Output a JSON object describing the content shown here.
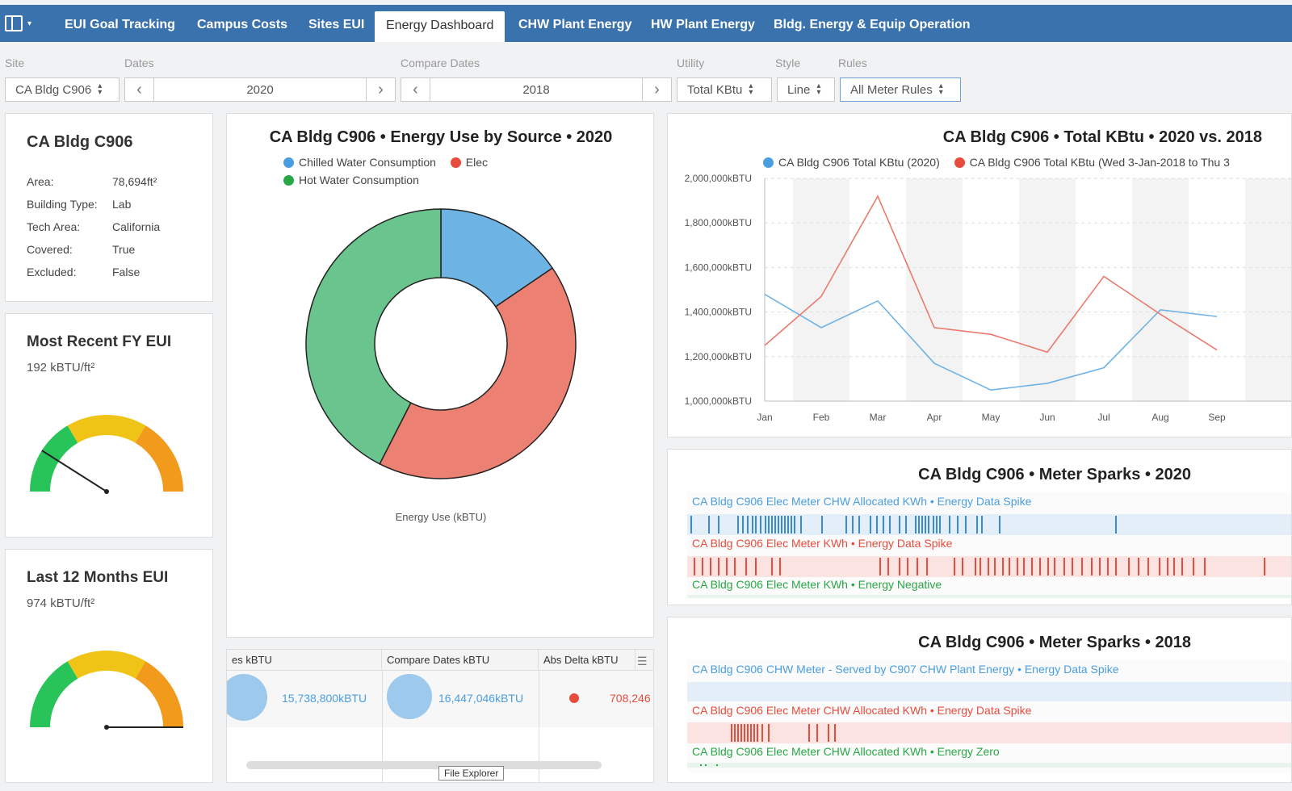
{
  "nav": {
    "tabs": [
      {
        "label": "EUI Goal Tracking"
      },
      {
        "label": "Campus Costs"
      },
      {
        "label": "Sites EUI"
      },
      {
        "label": "Energy Dashboard"
      },
      {
        "label": "CHW Plant Energy"
      },
      {
        "label": "HW Plant Energy"
      },
      {
        "label": "Bldg. Energy & Equip Operation"
      }
    ]
  },
  "filters": {
    "site_label": "Site",
    "site_value": "CA Bldg C906",
    "dates_label": "Dates",
    "dates_value": "2020",
    "compare_label": "Compare Dates",
    "compare_value": "2018",
    "utility_label": "Utility",
    "utility_value": "Total KBtu",
    "style_label": "Style",
    "style_value": "Line",
    "rules_label": "Rules",
    "rules_value": "All Meter Rules"
  },
  "building": {
    "title": "CA Bldg C906",
    "rows": [
      {
        "k": "Area:",
        "v": "78,694ft²"
      },
      {
        "k": "Building Type:",
        "v": "Lab"
      },
      {
        "k": "Tech Area:",
        "v": "California"
      },
      {
        "k": "Covered:",
        "v": "True"
      },
      {
        "k": "Excluded:",
        "v": "False"
      }
    ]
  },
  "eui_recent": {
    "title": "Most Recent FY EUI",
    "value": "192 kBTU/ft²",
    "level": 0.18
  },
  "eui_12m": {
    "title": "Last 12 Months EUI",
    "value": "974 kBTU/ft²",
    "level": 1.0
  },
  "donut": {
    "title": "CA Bldg C906 • Energy Use by Source  •  2020",
    "legend": [
      {
        "name": "Chilled Water Consumption",
        "color": "#4a9ee0"
      },
      {
        "name": "Elec",
        "color": "#e84c3d"
      },
      {
        "name": "Hot Water Consumption",
        "color": "#28a745"
      }
    ],
    "footer": "Energy Use (kBTU)"
  },
  "line": {
    "title": "CA Bldg C906  •  Total KBtu  •  2020 vs. 2018",
    "legend1": "CA Bldg C906 Total KBtu (2020)",
    "legend2": "CA Bldg C906 Total KBtu (Wed 3-Jan-2018 to Thu 3"
  },
  "spark2020": {
    "title": "CA Bldg C906  •  Meter Sparks  •  2020",
    "rows": [
      {
        "label": "CA Bldg C906 Elec Meter CHW Allocated KWh • Energy Data Spike"
      },
      {
        "label": "CA Bldg C906 Elec Meter KWh • Energy Data Spike"
      },
      {
        "label": "CA Bldg C906 Elec Meter KWh • Energy Negative"
      }
    ]
  },
  "spark2018": {
    "title": "CA Bldg C906  •  Meter Sparks  •  2018",
    "rows": [
      {
        "label": "CA Bldg C906 CHW Meter - Served by C907 CHW Plant Energy • Energy Data Spike"
      },
      {
        "label": "CA Bldg C906 Elec Meter CHW Allocated KWh • Energy Data Spike"
      },
      {
        "label": "CA Bldg C906 Elec Meter CHW Allocated KWh • Energy Zero"
      }
    ]
  },
  "table": {
    "col1": "es kBTU",
    "col2": "Compare Dates kBTU",
    "col3": "Abs Delta kBTU",
    "v1": "15,738,800kBTU",
    "v2": "16,447,046kBTU",
    "v3": "708,246",
    "tooltip": "File Explorer"
  },
  "colors": {
    "nav": "#3a72ad",
    "blue": "#4a9ee0",
    "red": "#e84c3d",
    "green": "#28a745"
  },
  "chart_data": {
    "type": "line",
    "title": "CA Bldg C906  •  Total KBtu  •  2020 vs. 2018",
    "categories": [
      "Jan",
      "Feb",
      "Mar",
      "Apr",
      "May",
      "Jun",
      "Jul",
      "Aug",
      "Sep"
    ],
    "ylim": [
      1000000000,
      2000000000
    ],
    "yticks": [
      "1,000,000kBTU",
      "1,200,000kBTU",
      "1,400,000kBTU",
      "1,600,000kBTU",
      "1,800,000kBTU",
      "2,000,000kBTU"
    ],
    "series": [
      {
        "name": "CA Bldg C906 Total KBtu (2020)",
        "color": "#6fb3e6",
        "values": [
          1480000000,
          1330000000,
          1450000000,
          1170000000,
          1050000000,
          1080000000,
          1150000000,
          1410000000,
          1380000000
        ]
      },
      {
        "name": "CA Bldg C906 Total KBtu (Wed 3-Jan-2018 to Thu 3",
        "color": "#ec7a6f",
        "values": [
          1250000000,
          1470000000,
          1920000000,
          1330000000,
          1300000000,
          1220000000,
          1560000000,
          1390000000,
          1230000000
        ]
      }
    ],
    "donut_values": [
      {
        "name": "Chilled Water Consumption",
        "value": 0.155,
        "color": "#6db3e4"
      },
      {
        "name": "Elec",
        "value": 0.42,
        "color": "#ec8072"
      },
      {
        "name": "Hot Water Consumption",
        "value": 0.425,
        "color": "#6ac48d"
      }
    ]
  }
}
